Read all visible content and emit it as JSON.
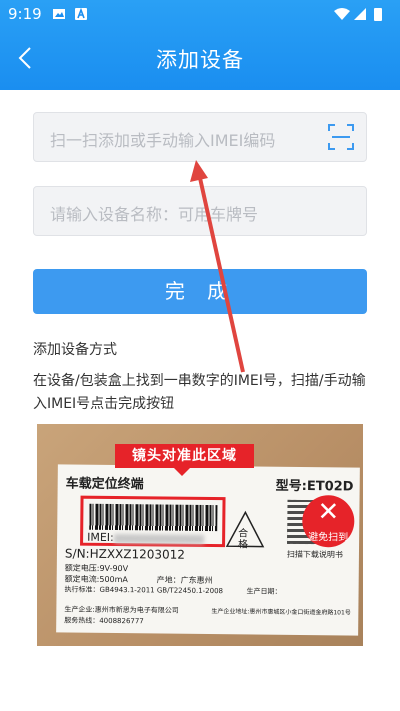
{
  "status_bar": {
    "time": "9:19"
  },
  "header": {
    "title": "添加设备",
    "back_icon": "chevron-left-icon"
  },
  "form": {
    "imei_placeholder": "扫一扫添加或手动输入IMEI编码",
    "name_placeholder": "请输入设备名称：可用车牌号",
    "scan_icon": "scan-icon",
    "submit_label": "完 成"
  },
  "guide": {
    "title": "添加设备方式",
    "description": "在设备/包装盒上找到一串数字的IMEI号，扫描/手动输入IMEI号点击完成按钮"
  },
  "photo": {
    "banner": "镜头对准此区域",
    "product_name": "车载定位终端",
    "model": "型号:ET02D",
    "imei_label": "IMEI:",
    "sn": "S/N:HZXXZ1203012",
    "voltage": "额定电压:9V-90V",
    "current": "额定电流:500mA",
    "origin": "产地：广东惠州",
    "standard": "执行标准：GB4943.1-2011 GB/T22450.1-2008",
    "production_date": "生产日期：",
    "qualified": "合格",
    "scan_download": "扫描下载说明书",
    "manufacturer": "生产企业:惠州市新思为电子有限公司",
    "hotline": "服务热线：4008826777",
    "address": "生产企业地址:惠州市惠城区小金口街道金府路101号",
    "avoid_badge": "避免扫到"
  },
  "colors": {
    "header": "#1a8ef0",
    "button": "#3d9af0",
    "accent_red": "#e62329"
  }
}
